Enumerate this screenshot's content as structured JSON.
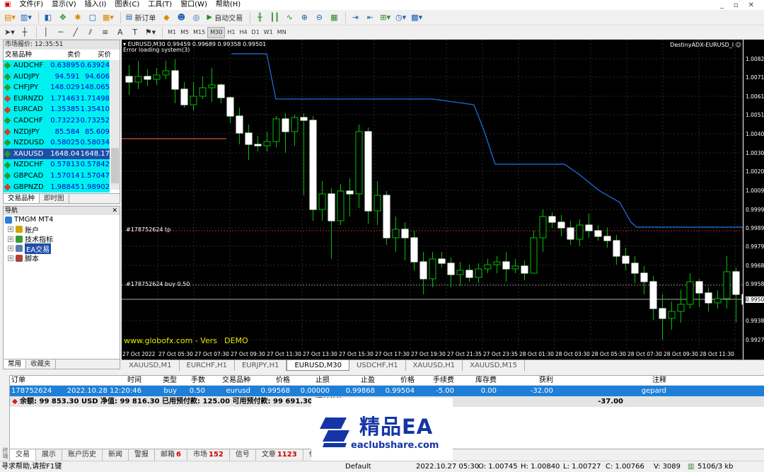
{
  "menu": [
    "文件(F)",
    "显示(V)",
    "插入(I)",
    "图表(C)",
    "工具(T)",
    "窗口(W)",
    "帮助(H)"
  ],
  "toolbar": {
    "new_order": "新订单",
    "auto_trade": "自动交易",
    "timeframes": [
      "M1",
      "M5",
      "M15",
      "M30",
      "H1",
      "H4",
      "D1",
      "W1",
      "MN"
    ],
    "active_tf": "M30"
  },
  "market_watch": {
    "title": "市场报价: 12:35:51",
    "headers": {
      "symbol": "交易品种",
      "bid": "卖价",
      "ask": "买价"
    },
    "rows": [
      {
        "symbol": "AUDCHF",
        "bid": "0.63895",
        "ask": "0.63924",
        "dir": "up"
      },
      {
        "symbol": "AUDJPY",
        "bid": "94.591",
        "ask": "94.606",
        "dir": "up"
      },
      {
        "symbol": "CHFJPY",
        "bid": "148.029",
        "ask": "148.065",
        "dir": "up"
      },
      {
        "symbol": "EURNZD",
        "bid": "1.71463",
        "ask": "1.71498",
        "dir": "down"
      },
      {
        "symbol": "EURCAD",
        "bid": "1.35385",
        "ask": "1.35410",
        "dir": "down"
      },
      {
        "symbol": "CADCHF",
        "bid": "0.73223",
        "ask": "0.73252",
        "dir": "up"
      },
      {
        "symbol": "NZDJPY",
        "bid": "85.584",
        "ask": "85.609",
        "dir": "down"
      },
      {
        "symbol": "NZDUSD",
        "bid": "0.58025",
        "ask": "0.58034",
        "dir": "up"
      },
      {
        "symbol": "XAUUSD",
        "bid": "1648.04",
        "ask": "1648.17",
        "dir": "up",
        "selected": true
      },
      {
        "symbol": "NZDCHF",
        "bid": "0.57813",
        "ask": "0.57842",
        "dir": "up"
      },
      {
        "symbol": "GBPCAD",
        "bid": "1.57014",
        "ask": "1.57047",
        "dir": "up"
      },
      {
        "symbol": "GBPNZD",
        "bid": "1.98845",
        "ask": "1.98902",
        "dir": "down"
      }
    ],
    "tabs": [
      "交易品种",
      "即时图"
    ]
  },
  "navigator": {
    "title": "导航",
    "root": "TMGM MT4",
    "items": [
      "账户",
      "技术指标",
      "EA交易",
      "脚本"
    ],
    "tabs": [
      "常用",
      "收藏夹"
    ]
  },
  "chart": {
    "header": "EURUSD,M30  0.99459 0.99689 0.99358 0.99501",
    "error": "Error loading system(3)",
    "indicator": "DestinyADX-EURUSD_I",
    "tp_label": "#178752624 tp",
    "buy_label": "#178752624 buy 0.50",
    "watermark": "www.globofx.com - Vers DEMO",
    "yticks": [
      "1.00820",
      "1.00715",
      "1.00610",
      "1.00510",
      "1.00405",
      "1.00300",
      "1.00200",
      "1.00095",
      "0.99990",
      "0.99890",
      "0.99790",
      "0.99685",
      "0.99580",
      "0.99501",
      "0.99380",
      "0.99275"
    ],
    "current_price": "0.99501",
    "xticks": [
      "27 Oct 2022",
      "27 Oct 05:30",
      "27 Oct 07:30",
      "27 Oct 09:30",
      "27 Oct 11:30",
      "27 Oct 13:30",
      "27 Oct 15:30",
      "27 Oct 17:30",
      "27 Oct 19:30",
      "27 Oct 21:35",
      "27 Oct 23:35",
      "28 Oct 01:30",
      "28 Oct 03:30",
      "28 Oct 05:30",
      "28 Oct 07:30",
      "28 Oct 09:30",
      "28 Oct 11:30"
    ],
    "colors": {
      "bg": "#000000",
      "bull": "#ffffff",
      "bear": "#ffffff",
      "wick": "#00c000",
      "line": "#1e73e8",
      "redline": "#ff6b4a",
      "grid": "#2a2a2a"
    }
  },
  "chart_tabs": [
    "XAUUSD,M1",
    "EURCHF,H1",
    "EURJPY,H1",
    "EURUSD,M30",
    "USDCHF,H1",
    "XAUUSD,H1",
    "XAUUSD,M15"
  ],
  "active_chart_tab": "EURUSD,M30",
  "terminal": {
    "headers": [
      "订单",
      "时间",
      "类型",
      "手数",
      "交易品种",
      "价格",
      "止损",
      "止盈",
      "价格",
      "手续费",
      "库存费",
      "获利",
      "注释"
    ],
    "row": [
      "178752624",
      "2022.10.28 12:20:46",
      "buy",
      "0.50",
      "eurusd",
      "0.99568",
      "0.00000",
      "0.99868",
      "0.99504",
      "-5.00",
      "0.00",
      "-32.00",
      "gepard"
    ],
    "balance": "余额: 99 853.30 USD  净值: 99 816.30  已用预付款: 125.00  可用预付款: 99 691.30  预付款比",
    "balance_total": "-37.00",
    "side_label": "终端",
    "tabs": [
      {
        "label": "交易",
        "count": ""
      },
      {
        "label": "展示",
        "count": ""
      },
      {
        "label": "账户历史",
        "count": ""
      },
      {
        "label": "新闻",
        "count": ""
      },
      {
        "label": "警报",
        "count": ""
      },
      {
        "label": "邮箱",
        "count": "6"
      },
      {
        "label": "市场",
        "count": "152"
      },
      {
        "label": "信号",
        "count": ""
      },
      {
        "label": "文章",
        "count": "1123"
      },
      {
        "label": "代码库",
        "count": ""
      }
    ]
  },
  "status": {
    "help": "寻求帮助,请按F1键",
    "profile": "Default",
    "datetime": "2022.10.27 05:30",
    "open": "O: 1.00745",
    "high": "H: 1.00840",
    "low": "L: 1.00727",
    "close": "C: 1.00766",
    "volume": "V: 3089",
    "traffic": "5106/3 kb"
  },
  "logo": {
    "main": "精品EA",
    "sub": "eaclubshare.com"
  }
}
